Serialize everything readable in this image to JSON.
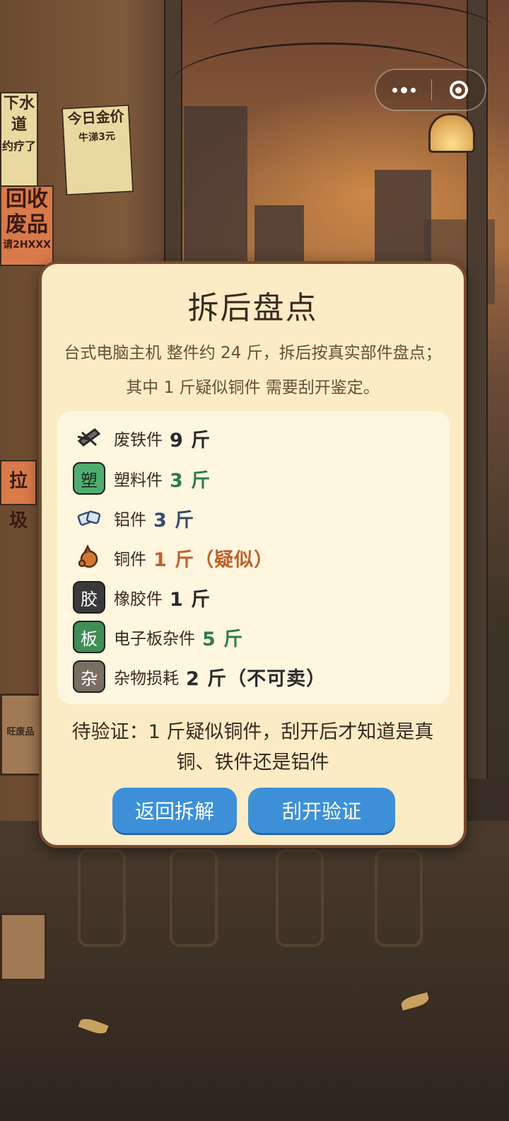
{
  "scene": {
    "posters": [
      "下水道",
      "约疗了",
      "今日金价",
      "牛涕3元",
      "回收",
      "废品",
      "请2HXXX",
      "拉圾",
      "旺废品"
    ]
  },
  "capsule": {
    "more_icon": "more-dots-icon",
    "close_icon": "target-close-icon"
  },
  "dialog": {
    "title": "拆后盘点",
    "description": "台式电脑主机 整件约 24 斤，拆后按真实部件盘点；其中 1 斤疑似铜件 需要刮开鉴定。",
    "items": [
      {
        "icon": "scrap-iron-icon",
        "glyph": "",
        "label": "废铁件",
        "quantity": "9 斤",
        "color": "#2a2a2a"
      },
      {
        "icon": "plastic-tile-icon",
        "glyph": "塑",
        "label": "塑料件",
        "quantity": "3 斤",
        "color": "#2f7d4a"
      },
      {
        "icon": "aluminum-icon",
        "glyph": "",
        "label": "铝件",
        "quantity": "3 斤",
        "color": "#3a4a6a"
      },
      {
        "icon": "copper-icon",
        "glyph": "",
        "label": "铜件",
        "quantity": "1 斤（疑似）",
        "color": "#c0602a"
      },
      {
        "icon": "rubber-tile-icon",
        "glyph": "胶",
        "label": "橡胶件",
        "quantity": "1 斤",
        "color": "#2a2a2a"
      },
      {
        "icon": "circuit-board-tile-icon",
        "glyph": "板",
        "label": "电子板杂件",
        "quantity": "5 斤",
        "color": "#2f7d4a"
      },
      {
        "icon": "misc-tile-icon",
        "glyph": "杂",
        "label": "杂物损耗",
        "quantity": "2 斤（不可卖）",
        "color": "#2a2a2a"
      }
    ],
    "pending_note": "待验证：1 斤疑似铜件，刮开后才知道是真铜、铁件还是铝件",
    "buttons": {
      "back": "返回拆解",
      "verify": "刮开验证"
    }
  },
  "colors": {
    "button": "#3d90d8",
    "panel": "#fbecc6",
    "border": "#7a4a30"
  }
}
